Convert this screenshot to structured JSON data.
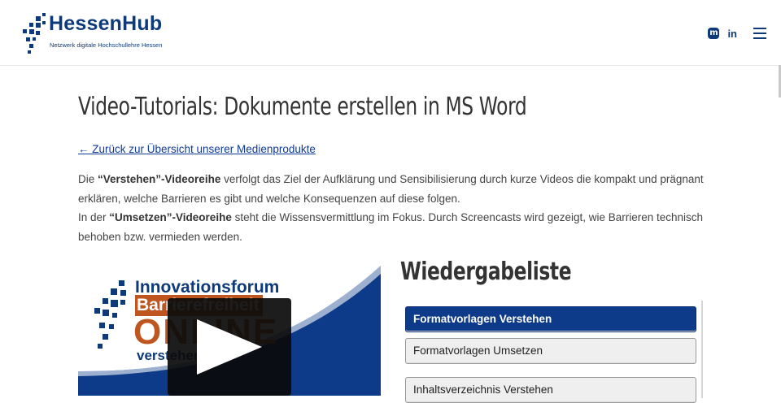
{
  "header": {
    "logo_title": "HessenHub",
    "logo_subtitle": "Netzwerk digitale Hochschullehre Hessen",
    "icons": [
      "mastodon-icon",
      "linkedin-icon",
      "menu-icon"
    ],
    "linkedin_text": "in",
    "mastodon_text": "m"
  },
  "main": {
    "title": "Video-Tutorials: Dokumente erstellen in MS Word",
    "back_link": "← Zurück zur Übersicht unserer Medienprodukte",
    "intro": {
      "p1_pre": "Die ",
      "p1_bold": "“Verstehen”-Videoreihe",
      "p1_post": " verfolgt das Ziel der Aufklärung und Sensibilisierung durch kurze Videos die kompakt und prägnant erklären, welche Barrieren es gibt und welche Konsequenzen auf diese folgen.",
      "p2_pre": "In der ",
      "p2_bold": "“Umsetzen”-Videoreihe",
      "p2_post": " steht die Wissensvermittlung im Fokus. Durch Screencasts wird gezeigt, wie Barrieren technisch behoben bzw. vermieden werden."
    },
    "video": {
      "line1": "Innovationsforum",
      "line2": "Barrierefreiheit",
      "line3": "ONLINE",
      "line4": "verstehen"
    },
    "playlist": {
      "title": "Wiedergabeliste",
      "items": [
        {
          "label": "Formatvorlagen Verstehen",
          "active": true
        },
        {
          "label": "Formatvorlagen Umsetzen",
          "active": false
        },
        {
          "label": "Inhaltsverzeichnis Verstehen",
          "active": false
        }
      ]
    }
  },
  "colors": {
    "brand_blue": "#0e3a7a",
    "active_item": "#0e3a8a",
    "accent_orange": "#c0561f"
  }
}
